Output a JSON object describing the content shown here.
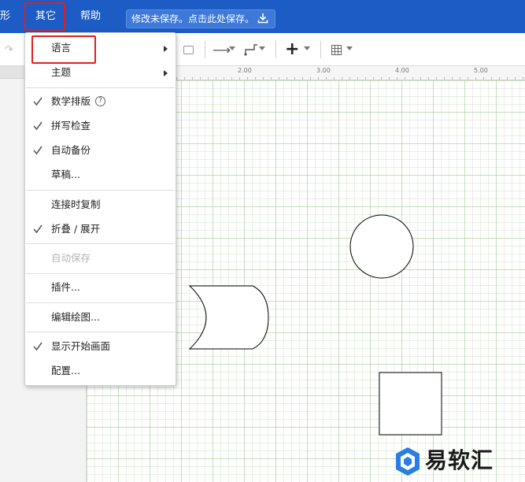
{
  "menubar": {
    "shape_label": "形",
    "other_label": "其它",
    "help_label": "帮助",
    "save_banner": "修改未保存。点击此处保存。"
  },
  "ruler": {
    "labels": [
      "2.00",
      "3.00",
      "4.00",
      "5.00"
    ]
  },
  "menu": {
    "items": [
      {
        "label": "语言",
        "checked": false,
        "submenu": true,
        "disabled": false
      },
      {
        "label": "主题",
        "checked": false,
        "submenu": true,
        "disabled": false
      },
      {
        "label": "数学排版",
        "checked": true,
        "submenu": false,
        "disabled": false,
        "help": "?"
      },
      {
        "label": "拼写检查",
        "checked": true,
        "submenu": false,
        "disabled": false
      },
      {
        "label": "自动备份",
        "checked": true,
        "submenu": false,
        "disabled": false
      },
      {
        "label": "草稿...",
        "checked": false,
        "submenu": false,
        "disabled": false
      },
      {
        "label": "连接时复制",
        "checked": false,
        "submenu": false,
        "disabled": false
      },
      {
        "label": "折叠 / 展开",
        "checked": true,
        "submenu": false,
        "disabled": false
      },
      {
        "label": "自动保存",
        "checked": false,
        "submenu": false,
        "disabled": true
      },
      {
        "label": "插件...",
        "checked": false,
        "submenu": false,
        "disabled": false
      },
      {
        "label": "编辑绘图...",
        "checked": false,
        "submenu": false,
        "disabled": false
      },
      {
        "label": "显示开始画面",
        "checked": true,
        "submenu": false,
        "disabled": false
      },
      {
        "label": "配置...",
        "checked": false,
        "submenu": false,
        "disabled": false
      }
    ]
  },
  "watermark": {
    "text": "易软汇"
  },
  "colors": {
    "menubar": "#1c5cc4",
    "highlight": "#e02020",
    "grid": "#aacda0"
  },
  "icons": [
    "redo-icon",
    "shadow-icon",
    "connection-arrow-icon",
    "waypoint-icon",
    "plus-icon",
    "table-icon",
    "download-icon",
    "check-icon",
    "help-icon",
    "submenu-arrow-icon"
  ]
}
